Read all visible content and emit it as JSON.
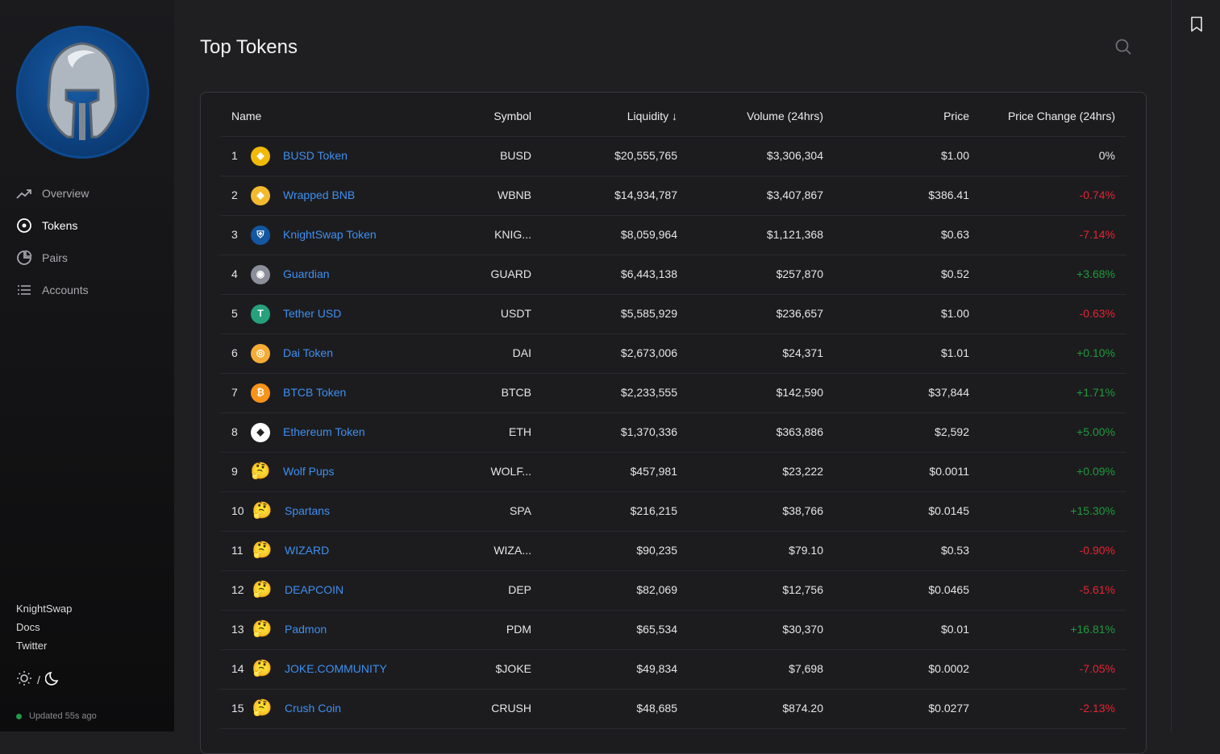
{
  "sidebar": {
    "nav": [
      {
        "label": "Overview",
        "icon": "trending-up-icon",
        "active": false
      },
      {
        "label": "Tokens",
        "icon": "target-icon",
        "active": true
      },
      {
        "label": "Pairs",
        "icon": "pie-chart-icon",
        "active": false
      },
      {
        "label": "Accounts",
        "icon": "list-icon",
        "active": false
      }
    ],
    "links": [
      "KnightSwap",
      "Docs",
      "Twitter"
    ],
    "theme_separator": "/",
    "status": "Updated 55s ago"
  },
  "page": {
    "title": "Top Tokens"
  },
  "table": {
    "headers": {
      "name": "Name",
      "symbol": "Symbol",
      "liquidity": "Liquidity ↓",
      "volume": "Volume (24hrs)",
      "price": "Price",
      "change": "Price Change (24hrs)"
    },
    "rows": [
      {
        "rank": "1",
        "name": "BUSD Token",
        "symbol": "BUSD",
        "liquidity": "$20,555,765",
        "volume": "$3,306,304",
        "price": "$1.00",
        "change": "0%",
        "dir": "zero",
        "icon": "busd",
        "color": "#f0b90b"
      },
      {
        "rank": "2",
        "name": "Wrapped BNB",
        "symbol": "WBNB",
        "liquidity": "$14,934,787",
        "volume": "$3,407,867",
        "price": "$386.41",
        "change": "-0.74%",
        "dir": "neg",
        "icon": "bnb",
        "color": "#f3ba2f"
      },
      {
        "rank": "3",
        "name": "KnightSwap Token",
        "symbol": "KNIG...",
        "liquidity": "$8,059,964",
        "volume": "$1,121,368",
        "price": "$0.63",
        "change": "-7.14%",
        "dir": "neg",
        "icon": "knight",
        "color": "#1357a1"
      },
      {
        "rank": "4",
        "name": "Guardian",
        "symbol": "GUARD",
        "liquidity": "$6,443,138",
        "volume": "$257,870",
        "price": "$0.52",
        "change": "+3.68%",
        "dir": "pos",
        "icon": "guardian",
        "color": "#8a8f99"
      },
      {
        "rank": "5",
        "name": "Tether USD",
        "symbol": "USDT",
        "liquidity": "$5,585,929",
        "volume": "$236,657",
        "price": "$1.00",
        "change": "-0.63%",
        "dir": "neg",
        "icon": "tether",
        "color": "#26a17b"
      },
      {
        "rank": "6",
        "name": "Dai Token",
        "symbol": "DAI",
        "liquidity": "$2,673,006",
        "volume": "$24,371",
        "price": "$1.01",
        "change": "+0.10%",
        "dir": "pos",
        "icon": "dai",
        "color": "#f5ac37"
      },
      {
        "rank": "7",
        "name": "BTCB Token",
        "symbol": "BTCB",
        "liquidity": "$2,233,555",
        "volume": "$142,590",
        "price": "$37,844",
        "change": "+1.71%",
        "dir": "pos",
        "icon": "btc",
        "color": "#f7931a"
      },
      {
        "rank": "8",
        "name": "Ethereum Token",
        "symbol": "ETH",
        "liquidity": "$1,370,336",
        "volume": "$363,886",
        "price": "$2,592",
        "change": "+5.00%",
        "dir": "pos",
        "icon": "eth",
        "color": "#ffffff"
      },
      {
        "rank": "9",
        "name": "Wolf Pups",
        "symbol": "WOLF...",
        "liquidity": "$457,981",
        "volume": "$23,222",
        "price": "$0.0011",
        "change": "+0.09%",
        "dir": "pos",
        "icon": "thinking",
        "color": "#f7c948"
      },
      {
        "rank": "10",
        "name": "Spartans",
        "symbol": "SPA",
        "liquidity": "$216,215",
        "volume": "$38,766",
        "price": "$0.0145",
        "change": "+15.30%",
        "dir": "pos",
        "icon": "thinking",
        "color": "#f7c948"
      },
      {
        "rank": "11",
        "name": "WIZARD",
        "symbol": "WIZA...",
        "liquidity": "$90,235",
        "volume": "$79.10",
        "price": "$0.53",
        "change": "-0.90%",
        "dir": "neg",
        "icon": "thinking",
        "color": "#f7c948"
      },
      {
        "rank": "12",
        "name": "DEAPCOIN",
        "symbol": "DEP",
        "liquidity": "$82,069",
        "volume": "$12,756",
        "price": "$0.0465",
        "change": "-5.61%",
        "dir": "neg",
        "icon": "thinking",
        "color": "#f7c948"
      },
      {
        "rank": "13",
        "name": "Padmon",
        "symbol": "PDM",
        "liquidity": "$65,534",
        "volume": "$30,370",
        "price": "$0.01",
        "change": "+16.81%",
        "dir": "pos",
        "icon": "thinking",
        "color": "#f7c948"
      },
      {
        "rank": "14",
        "name": "JOKE.COMMUNITY",
        "symbol": "$JOKE",
        "liquidity": "$49,834",
        "volume": "$7,698",
        "price": "$0.0002",
        "change": "-7.05%",
        "dir": "neg",
        "icon": "thinking",
        "color": "#f7c948"
      },
      {
        "rank": "15",
        "name": "Crush Coin",
        "symbol": "CRUSH",
        "liquidity": "$48,685",
        "volume": "$874.20",
        "price": "$0.0277",
        "change": "-2.13%",
        "dir": "neg",
        "icon": "thinking",
        "color": "#f7c948"
      }
    ]
  }
}
